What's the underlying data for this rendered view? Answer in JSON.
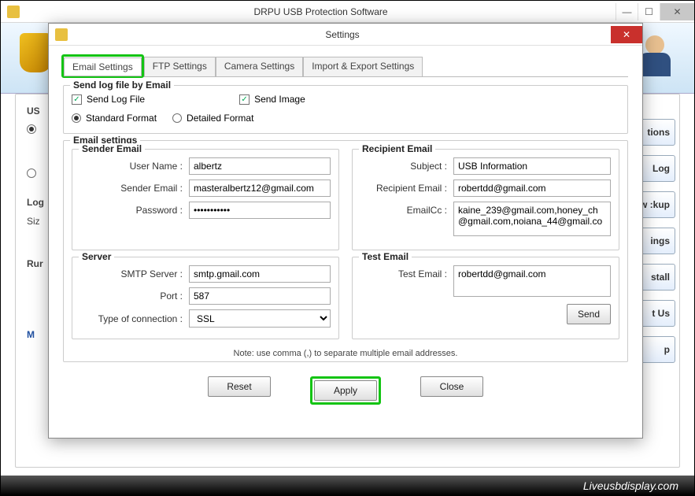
{
  "outer": {
    "title": "DRPU USB Protection Software",
    "min": "—",
    "max": "☐",
    "close": "✕",
    "left_panel": {
      "usb": "US",
      "log": "Log",
      "size": "Siz",
      "run": "Rur",
      "mode": "M"
    },
    "side_buttons": [
      "tions",
      "Log",
      "ew :kup",
      "ings",
      "stall",
      "t Us",
      "p"
    ]
  },
  "modal": {
    "title": "Settings",
    "close": "✕",
    "tabs": {
      "email": "Email Settings",
      "ftp": "FTP Settings",
      "camera": "Camera Settings",
      "importexport": "Import & Export Settings"
    },
    "send_group": {
      "legend": "Send log file by Email",
      "send_log": "Send Log File",
      "send_image": "Send Image",
      "standard": "Standard Format",
      "detailed": "Detailed Format"
    },
    "email_group": {
      "legend": "Email settings"
    },
    "sender": {
      "legend": "Sender Email",
      "username_lbl": "User Name :",
      "username": "albertz",
      "email_lbl": "Sender Email :",
      "email": "masteralbertz12@gmail.com",
      "password_lbl": "Password :",
      "password": "•••••••••••"
    },
    "recipient": {
      "legend": "Recipient Email",
      "subject_lbl": "Subject :",
      "subject": "USB Information",
      "email_lbl": "Recipient Email :",
      "email": "robertdd@gmail.com",
      "cc_lbl": "EmailCc :",
      "cc": "kaine_239@gmail.com,honey_ch@gmail.com,noiana_44@gmail.co"
    },
    "server": {
      "legend": "Server",
      "smtp_lbl": "SMTP Server :",
      "smtp": "smtp.gmail.com",
      "port_lbl": "Port :",
      "port": "587",
      "conn_lbl": "Type of connection :",
      "conn": "SSL"
    },
    "test": {
      "legend": "Test Email",
      "lbl": "Test Email :",
      "value": "robertdd@gmail.com",
      "send": "Send"
    },
    "note": "Note: use comma (,) to separate multiple email addresses.",
    "btns": {
      "reset": "Reset",
      "apply": "Apply",
      "close": "Close"
    }
  },
  "footer": "Liveusbdisplay.com"
}
